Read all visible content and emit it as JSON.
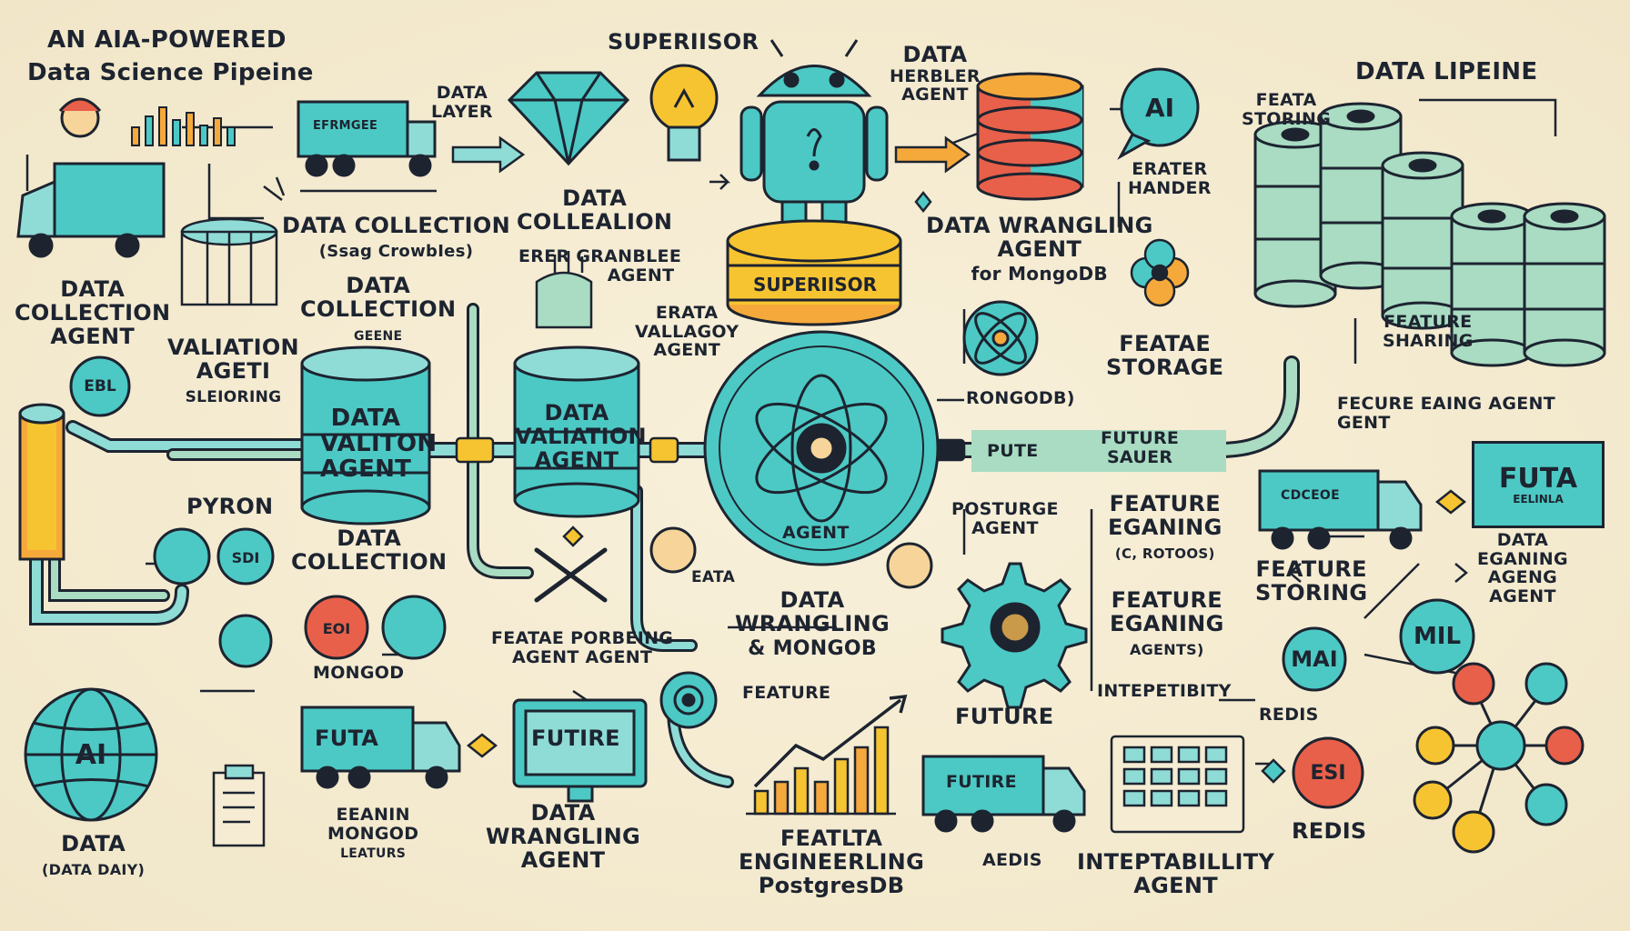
{
  "colors": {
    "background": "#f5ecd3",
    "teal": "#4cc9c4",
    "teal_light": "#8fdcd6",
    "mint": "#a9dcc2",
    "orange": "#f6a93b",
    "yellow": "#f7c431",
    "coral": "#e8604a",
    "outline": "#1d2430"
  },
  "labels": {
    "title_line1": "AN AIA-POWERED",
    "title_line2": "Data Science Pipeine",
    "superior_top": "SUPERIISOR",
    "data_herbler_1": "DATA",
    "data_herbler_2": "HERBLER",
    "data_herbler_3": "AGENT",
    "data_lipeine": "DATA LIPEINE",
    "data_layer_1": "DATA",
    "data_layer_2": "LAYER",
    "feata_storing_1": "FEATA",
    "feata_storing_2": "STORING",
    "erater_1": "ERATER",
    "erater_2": "HANDER",
    "dc_scrawbles_1": "DATA COLLECTION",
    "dc_scrawbles_2": "(Ssag CrowbIes)",
    "data_colleation_1": "DATA",
    "data_colleation_2": "COLLEALION",
    "erer_1": "ERER GRANBLEE",
    "erer_2": "AGENT",
    "superior_pedestal": "SUPERIISOR",
    "dw_mongo_1": "DATA WRANGLING",
    "dw_mongo_2": "AGENT",
    "dw_mongo_3": "for MongoDB",
    "dca_1": "DATA",
    "dca_2": "COLLECTION",
    "dca_3": "AGENT",
    "dc_mid_1": "DATA",
    "dc_mid_2": "COLLECTION",
    "dc_mid_3": "GEENE",
    "vali_1": "VALIATION",
    "vali_2": "AGETI",
    "vali_3": "SLEIORING",
    "erata_1": "ERATA",
    "erata_2": "VALLAGOY",
    "erata_3": "AGENT",
    "featae_1": "FEATAE",
    "featae_2": "STORAGE",
    "rongodb": "RONGODB)",
    "feature_shaing_1": "FEATURE",
    "feature_shaing_2": "SHARING",
    "fecure_1": "FECURE EAING AGENT",
    "fecure_2": "GENT",
    "barrel1_1": "DATA",
    "barrel1_2": "VALITON",
    "barrel1_3": "AGENT",
    "barrel2_1": "DATA",
    "barrel2_2": "VALIATION",
    "barrel2_3": "AGENT",
    "pute": "PUTE",
    "future_sauer_1": "FUTURE",
    "future_sauer_2": "SAUER",
    "futa_box_1": "FUTA",
    "futa_box_2": "EELINLA",
    "pyron": "PYRON",
    "agent_wheel": "AGENT",
    "posturge_1": "POSTURGE",
    "posturge_2": "AGENT",
    "fe_right_1": "FEATURE",
    "fe_right_2": "EGANING",
    "fe_right_3": "(C, ROTOOS)",
    "dc_low_1": "DATA",
    "dc_low_2": "COLLECTION",
    "eata": "EATA",
    "feature_storing_1": "FEATURE",
    "feature_storing_2": "STORING",
    "dea_1": "DATA",
    "dea_2": "EGANING",
    "dea_3": "AGENG",
    "dea_4": "AGENT",
    "fe2_1": "FEATURE",
    "fe2_2": "EGANING",
    "fe2_3": "AGENTS)",
    "feat_porc_1": "FEATAE PORBEING",
    "feat_porc_2": "AGENT AGENT",
    "mongod": "MONGOD",
    "dwm_1": "DATA",
    "dwm_2": "WRANGLING",
    "dwm_3": "& MONGOB",
    "intepetibity": "INTEPETIBITY",
    "feature_mid": "FEATURE",
    "redis_1": "REDIS",
    "redis_2": "REDIS",
    "futa_truck": "FUTA",
    "futire_monitor": "FUTIRE",
    "future_label": "FUTURE",
    "future_truck2": "FUTIRE",
    "eeanin_1": "EEANIN",
    "eeanin_2": "MONGOD",
    "eeanin_3": "LEATURS",
    "dwa_1": "DATA",
    "dwa_2": "WRANGLING",
    "dwa_3": "AGENT",
    "fe_pg_1": "FEATLTA",
    "fe_pg_2": "ENGINEERLING",
    "fe_pg_3": "PostgresDB",
    "aedis": "AEDIS",
    "interp_1": "INTEPTABILLITY",
    "interp_2": "AGENT",
    "data_bottom_1": "DATA",
    "data_bottom_2": "(DATA DAIY)",
    "ai_globe": "AI",
    "ai_bubble": "AI",
    "mal": "MAI",
    "mil": "MIL",
    "esi": "ESI",
    "ebl": "EBL",
    "sdi": "SDI",
    "eoi": "EOI",
    "truck_top_text": "EFRMGEE",
    "truck_right_text": "CDCEOE"
  }
}
